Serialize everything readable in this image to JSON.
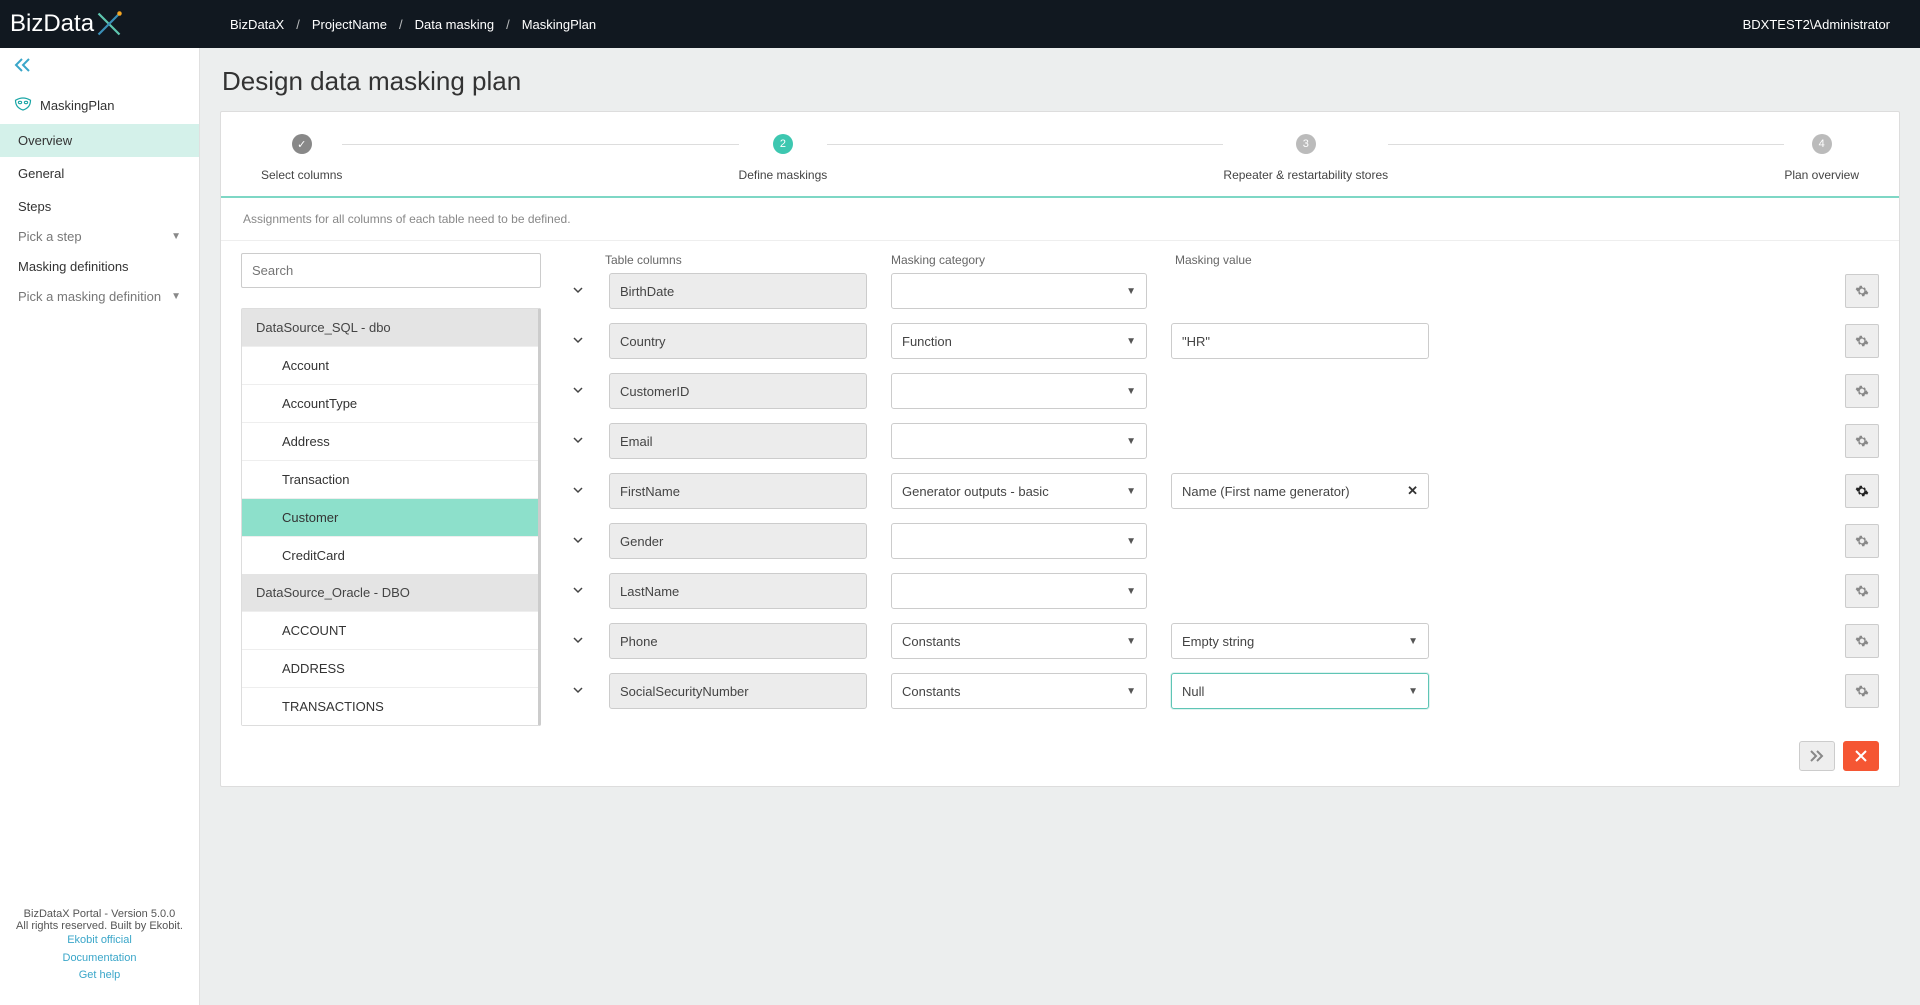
{
  "header": {
    "logo_text": "BizData",
    "breadcrumbs": [
      "BizDataX",
      "ProjectName",
      "Data masking",
      "MaskingPlan"
    ],
    "user": "BDXTEST2\\Administrator"
  },
  "sidebar": {
    "plan_name": "MaskingPlan",
    "nav": {
      "overview": "Overview",
      "general": "General"
    },
    "steps_label": "Steps",
    "steps_placeholder": "Pick a step",
    "defs_label": "Masking definitions",
    "defs_placeholder": "Pick a masking definition",
    "footer": {
      "line1": "BizDataX Portal - Version 5.0.0",
      "line2": "All rights reserved. Built by Ekobit.",
      "link1": "Ekobit official",
      "link2": "Documentation",
      "link3": "Get help"
    }
  },
  "page": {
    "title": "Design data masking plan",
    "steps": [
      {
        "num": "✓",
        "label": "Select columns",
        "state": "done"
      },
      {
        "num": "2",
        "label": "Define maskings",
        "state": "active"
      },
      {
        "num": "3",
        "label": "Repeater & restartability stores",
        "state": ""
      },
      {
        "num": "4",
        "label": "Plan overview",
        "state": ""
      }
    ],
    "instructions": "Assignments for all columns of each table need to be defined."
  },
  "search": {
    "placeholder": "Search"
  },
  "tree": [
    {
      "type": "group",
      "label": "DataSource_SQL - dbo"
    },
    {
      "type": "item",
      "label": "Account"
    },
    {
      "type": "item",
      "label": "AccountType"
    },
    {
      "type": "item",
      "label": "Address"
    },
    {
      "type": "item",
      "label": "Transaction"
    },
    {
      "type": "item",
      "label": "Customer",
      "selected": true
    },
    {
      "type": "item",
      "label": "CreditCard"
    },
    {
      "type": "group",
      "label": "DataSource_Oracle - DBO"
    },
    {
      "type": "item",
      "label": "ACCOUNT"
    },
    {
      "type": "item",
      "label": "ADDRESS"
    },
    {
      "type": "item",
      "label": "TRANSACTIONS"
    }
  ],
  "columns_header": {
    "c1": "Table columns",
    "c2": "Masking category",
    "c3": "Masking value"
  },
  "rows": [
    {
      "col": "BirthDate",
      "category": "",
      "value_type": "none"
    },
    {
      "col": "Country",
      "category": "Function",
      "value_type": "text",
      "value": "\"HR\""
    },
    {
      "col": "CustomerID",
      "category": "",
      "value_type": "none"
    },
    {
      "col": "Email",
      "category": "",
      "value_type": "none"
    },
    {
      "col": "FirstName",
      "category": "Generator outputs - basic",
      "value_type": "clear",
      "value": "Name (First name generator)",
      "gear": "dark"
    },
    {
      "col": "Gender",
      "category": "",
      "value_type": "none"
    },
    {
      "col": "LastName",
      "category": "",
      "value_type": "none"
    },
    {
      "col": "Phone",
      "category": "Constants",
      "value_type": "dropdown",
      "value": "Empty string"
    },
    {
      "col": "SocialSecurityNumber",
      "category": "Constants",
      "value_type": "dropdown",
      "value": "Null",
      "highlight": true
    }
  ]
}
